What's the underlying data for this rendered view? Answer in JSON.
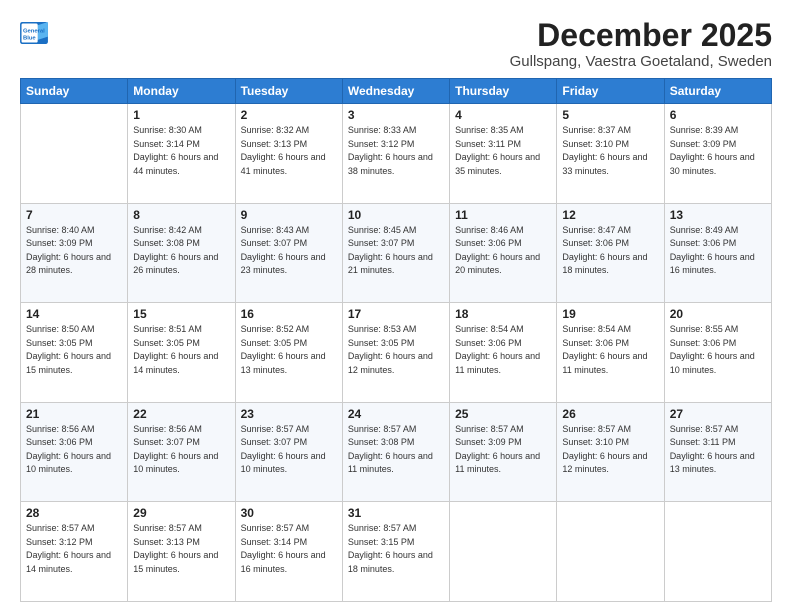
{
  "logo": {
    "line1": "General",
    "line2": "Blue"
  },
  "title": "December 2025",
  "location": "Gullspang, Vaestra Goetaland, Sweden",
  "weekdays": [
    "Sunday",
    "Monday",
    "Tuesday",
    "Wednesday",
    "Thursday",
    "Friday",
    "Saturday"
  ],
  "weeks": [
    [
      {
        "day": "",
        "sunrise": "",
        "sunset": "",
        "daylight": ""
      },
      {
        "day": "1",
        "sunrise": "Sunrise: 8:30 AM",
        "sunset": "Sunset: 3:14 PM",
        "daylight": "Daylight: 6 hours and 44 minutes."
      },
      {
        "day": "2",
        "sunrise": "Sunrise: 8:32 AM",
        "sunset": "Sunset: 3:13 PM",
        "daylight": "Daylight: 6 hours and 41 minutes."
      },
      {
        "day": "3",
        "sunrise": "Sunrise: 8:33 AM",
        "sunset": "Sunset: 3:12 PM",
        "daylight": "Daylight: 6 hours and 38 minutes."
      },
      {
        "day": "4",
        "sunrise": "Sunrise: 8:35 AM",
        "sunset": "Sunset: 3:11 PM",
        "daylight": "Daylight: 6 hours and 35 minutes."
      },
      {
        "day": "5",
        "sunrise": "Sunrise: 8:37 AM",
        "sunset": "Sunset: 3:10 PM",
        "daylight": "Daylight: 6 hours and 33 minutes."
      },
      {
        "day": "6",
        "sunrise": "Sunrise: 8:39 AM",
        "sunset": "Sunset: 3:09 PM",
        "daylight": "Daylight: 6 hours and 30 minutes."
      }
    ],
    [
      {
        "day": "7",
        "sunrise": "Sunrise: 8:40 AM",
        "sunset": "Sunset: 3:09 PM",
        "daylight": "Daylight: 6 hours and 28 minutes."
      },
      {
        "day": "8",
        "sunrise": "Sunrise: 8:42 AM",
        "sunset": "Sunset: 3:08 PM",
        "daylight": "Daylight: 6 hours and 26 minutes."
      },
      {
        "day": "9",
        "sunrise": "Sunrise: 8:43 AM",
        "sunset": "Sunset: 3:07 PM",
        "daylight": "Daylight: 6 hours and 23 minutes."
      },
      {
        "day": "10",
        "sunrise": "Sunrise: 8:45 AM",
        "sunset": "Sunset: 3:07 PM",
        "daylight": "Daylight: 6 hours and 21 minutes."
      },
      {
        "day": "11",
        "sunrise": "Sunrise: 8:46 AM",
        "sunset": "Sunset: 3:06 PM",
        "daylight": "Daylight: 6 hours and 20 minutes."
      },
      {
        "day": "12",
        "sunrise": "Sunrise: 8:47 AM",
        "sunset": "Sunset: 3:06 PM",
        "daylight": "Daylight: 6 hours and 18 minutes."
      },
      {
        "day": "13",
        "sunrise": "Sunrise: 8:49 AM",
        "sunset": "Sunset: 3:06 PM",
        "daylight": "Daylight: 6 hours and 16 minutes."
      }
    ],
    [
      {
        "day": "14",
        "sunrise": "Sunrise: 8:50 AM",
        "sunset": "Sunset: 3:05 PM",
        "daylight": "Daylight: 6 hours and 15 minutes."
      },
      {
        "day": "15",
        "sunrise": "Sunrise: 8:51 AM",
        "sunset": "Sunset: 3:05 PM",
        "daylight": "Daylight: 6 hours and 14 minutes."
      },
      {
        "day": "16",
        "sunrise": "Sunrise: 8:52 AM",
        "sunset": "Sunset: 3:05 PM",
        "daylight": "Daylight: 6 hours and 13 minutes."
      },
      {
        "day": "17",
        "sunrise": "Sunrise: 8:53 AM",
        "sunset": "Sunset: 3:05 PM",
        "daylight": "Daylight: 6 hours and 12 minutes."
      },
      {
        "day": "18",
        "sunrise": "Sunrise: 8:54 AM",
        "sunset": "Sunset: 3:06 PM",
        "daylight": "Daylight: 6 hours and 11 minutes."
      },
      {
        "day": "19",
        "sunrise": "Sunrise: 8:54 AM",
        "sunset": "Sunset: 3:06 PM",
        "daylight": "Daylight: 6 hours and 11 minutes."
      },
      {
        "day": "20",
        "sunrise": "Sunrise: 8:55 AM",
        "sunset": "Sunset: 3:06 PM",
        "daylight": "Daylight: 6 hours and 10 minutes."
      }
    ],
    [
      {
        "day": "21",
        "sunrise": "Sunrise: 8:56 AM",
        "sunset": "Sunset: 3:06 PM",
        "daylight": "Daylight: 6 hours and 10 minutes."
      },
      {
        "day": "22",
        "sunrise": "Sunrise: 8:56 AM",
        "sunset": "Sunset: 3:07 PM",
        "daylight": "Daylight: 6 hours and 10 minutes."
      },
      {
        "day": "23",
        "sunrise": "Sunrise: 8:57 AM",
        "sunset": "Sunset: 3:07 PM",
        "daylight": "Daylight: 6 hours and 10 minutes."
      },
      {
        "day": "24",
        "sunrise": "Sunrise: 8:57 AM",
        "sunset": "Sunset: 3:08 PM",
        "daylight": "Daylight: 6 hours and 11 minutes."
      },
      {
        "day": "25",
        "sunrise": "Sunrise: 8:57 AM",
        "sunset": "Sunset: 3:09 PM",
        "daylight": "Daylight: 6 hours and 11 minutes."
      },
      {
        "day": "26",
        "sunrise": "Sunrise: 8:57 AM",
        "sunset": "Sunset: 3:10 PM",
        "daylight": "Daylight: 6 hours and 12 minutes."
      },
      {
        "day": "27",
        "sunrise": "Sunrise: 8:57 AM",
        "sunset": "Sunset: 3:11 PM",
        "daylight": "Daylight: 6 hours and 13 minutes."
      }
    ],
    [
      {
        "day": "28",
        "sunrise": "Sunrise: 8:57 AM",
        "sunset": "Sunset: 3:12 PM",
        "daylight": "Daylight: 6 hours and 14 minutes."
      },
      {
        "day": "29",
        "sunrise": "Sunrise: 8:57 AM",
        "sunset": "Sunset: 3:13 PM",
        "daylight": "Daylight: 6 hours and 15 minutes."
      },
      {
        "day": "30",
        "sunrise": "Sunrise: 8:57 AM",
        "sunset": "Sunset: 3:14 PM",
        "daylight": "Daylight: 6 hours and 16 minutes."
      },
      {
        "day": "31",
        "sunrise": "Sunrise: 8:57 AM",
        "sunset": "Sunset: 3:15 PM",
        "daylight": "Daylight: 6 hours and 18 minutes."
      },
      {
        "day": "",
        "sunrise": "",
        "sunset": "",
        "daylight": ""
      },
      {
        "day": "",
        "sunrise": "",
        "sunset": "",
        "daylight": ""
      },
      {
        "day": "",
        "sunrise": "",
        "sunset": "",
        "daylight": ""
      }
    ]
  ]
}
